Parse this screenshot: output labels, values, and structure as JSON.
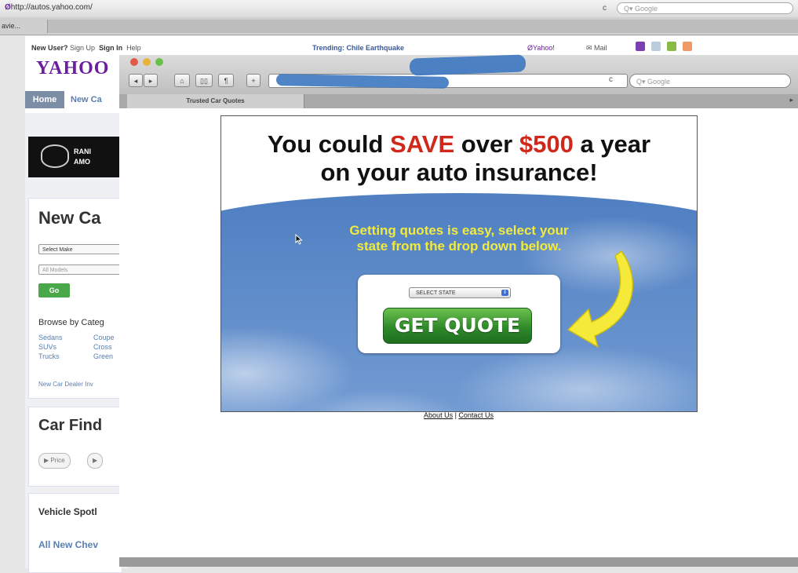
{
  "background_browser": {
    "url": "http://autos.yahoo.com/",
    "search_placeholder": "Q▾ Google",
    "tab_label": "avie..."
  },
  "yahoo": {
    "topbar": {
      "new_user": "New User?",
      "sign_up": "Sign Up",
      "sign_in": "Sign In",
      "help": "Help",
      "trending": "Trending: Chile Earthquake",
      "yahoo_link": "Yahoo!",
      "mail_link": "Mail"
    },
    "logo": "YAHOO",
    "nav": {
      "home": "Home",
      "new_cars": "New Ca"
    },
    "ranking": {
      "line1": "RANI",
      "line2": "AMO"
    },
    "new_cars_card": {
      "title": "New Ca",
      "select_make": "Select Make",
      "all_models": "All Models",
      "go": "Go",
      "browse_title": "Browse by Categ",
      "categories_col1": [
        "Sedans",
        "SUVs",
        "Trucks"
      ],
      "categories_col2": [
        "Coupe",
        "Cross",
        "Green"
      ],
      "dealer_link": "New Car Dealer Inv"
    },
    "car_finder": {
      "title": "Car Find",
      "pills": [
        "▶ Price",
        "▶ "
      ]
    },
    "spotlight": {
      "title": "Vehicle Spotl",
      "subtitle": "All New Chev"
    }
  },
  "popup": {
    "search_placeholder": "Q▾ Google",
    "tab_label": "Trusted Car Quotes",
    "ad": {
      "headline_1": "You could ",
      "headline_save": "SAVE",
      "headline_2": " over ",
      "headline_amount": "$500",
      "headline_3": " a year",
      "headline_line2": "on your auto insurance!",
      "subline_1": "Getting quotes is easy, select your",
      "subline_2": "state from the drop down below.",
      "select_state": "SELECT STATE",
      "button": "GET QUOTE"
    },
    "footer": {
      "about": "About Us",
      "separator": " | ",
      "contact": "Contact Us"
    }
  },
  "colors": {
    "yahoo_purple": "#6b1f9e",
    "save_red": "#d0281b",
    "subline_yellow": "#f2ea3d",
    "button_green": "#2f8a2a",
    "sky_blue": "#4f7fc2",
    "redaction_blue": "#3c78c0"
  },
  "icons": [
    "back-icon",
    "forward-icon",
    "home-icon",
    "bookmarks-icon",
    "add-bookmark-icon",
    "reload-icon",
    "yellow-arrow-icon",
    "mouse-cursor-icon"
  ]
}
